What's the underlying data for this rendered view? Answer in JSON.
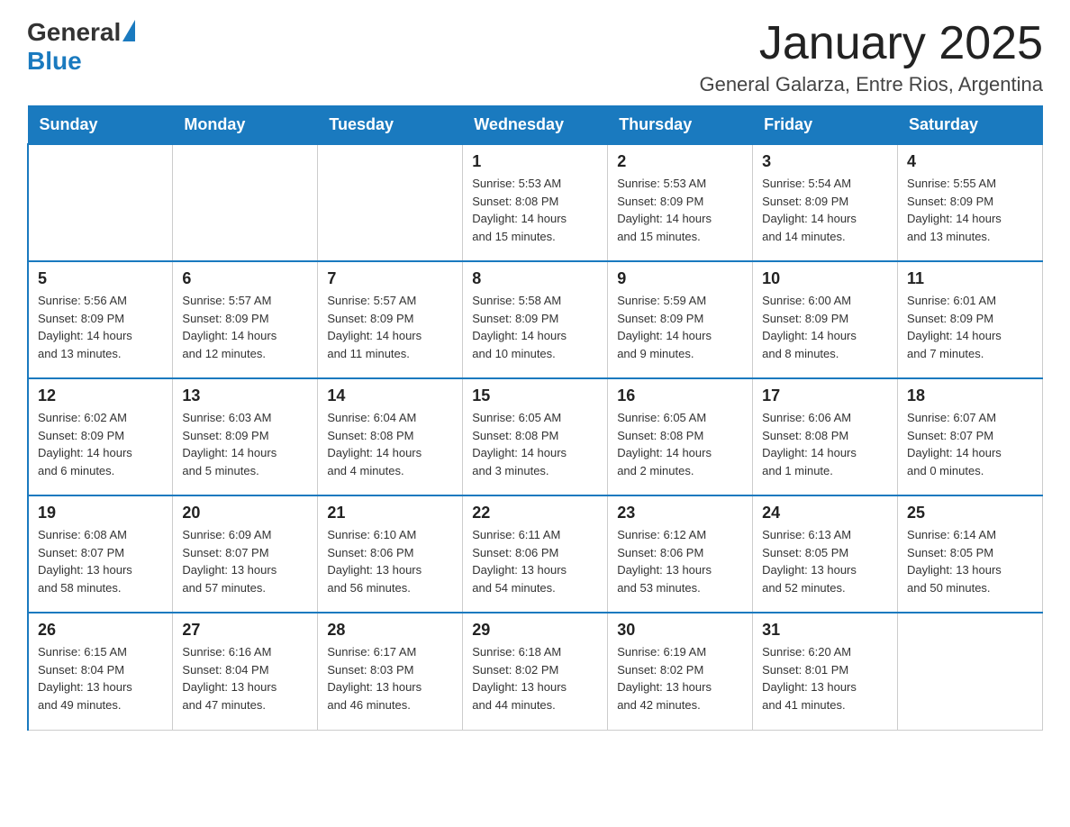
{
  "logo": {
    "general": "General",
    "blue": "Blue"
  },
  "title": "January 2025",
  "subtitle": "General Galarza, Entre Rios, Argentina",
  "days_of_week": [
    "Sunday",
    "Monday",
    "Tuesday",
    "Wednesday",
    "Thursday",
    "Friday",
    "Saturday"
  ],
  "weeks": [
    [
      {
        "day": "",
        "info": ""
      },
      {
        "day": "",
        "info": ""
      },
      {
        "day": "",
        "info": ""
      },
      {
        "day": "1",
        "info": "Sunrise: 5:53 AM\nSunset: 8:08 PM\nDaylight: 14 hours\nand 15 minutes."
      },
      {
        "day": "2",
        "info": "Sunrise: 5:53 AM\nSunset: 8:09 PM\nDaylight: 14 hours\nand 15 minutes."
      },
      {
        "day": "3",
        "info": "Sunrise: 5:54 AM\nSunset: 8:09 PM\nDaylight: 14 hours\nand 14 minutes."
      },
      {
        "day": "4",
        "info": "Sunrise: 5:55 AM\nSunset: 8:09 PM\nDaylight: 14 hours\nand 13 minutes."
      }
    ],
    [
      {
        "day": "5",
        "info": "Sunrise: 5:56 AM\nSunset: 8:09 PM\nDaylight: 14 hours\nand 13 minutes."
      },
      {
        "day": "6",
        "info": "Sunrise: 5:57 AM\nSunset: 8:09 PM\nDaylight: 14 hours\nand 12 minutes."
      },
      {
        "day": "7",
        "info": "Sunrise: 5:57 AM\nSunset: 8:09 PM\nDaylight: 14 hours\nand 11 minutes."
      },
      {
        "day": "8",
        "info": "Sunrise: 5:58 AM\nSunset: 8:09 PM\nDaylight: 14 hours\nand 10 minutes."
      },
      {
        "day": "9",
        "info": "Sunrise: 5:59 AM\nSunset: 8:09 PM\nDaylight: 14 hours\nand 9 minutes."
      },
      {
        "day": "10",
        "info": "Sunrise: 6:00 AM\nSunset: 8:09 PM\nDaylight: 14 hours\nand 8 minutes."
      },
      {
        "day": "11",
        "info": "Sunrise: 6:01 AM\nSunset: 8:09 PM\nDaylight: 14 hours\nand 7 minutes."
      }
    ],
    [
      {
        "day": "12",
        "info": "Sunrise: 6:02 AM\nSunset: 8:09 PM\nDaylight: 14 hours\nand 6 minutes."
      },
      {
        "day": "13",
        "info": "Sunrise: 6:03 AM\nSunset: 8:09 PM\nDaylight: 14 hours\nand 5 minutes."
      },
      {
        "day": "14",
        "info": "Sunrise: 6:04 AM\nSunset: 8:08 PM\nDaylight: 14 hours\nand 4 minutes."
      },
      {
        "day": "15",
        "info": "Sunrise: 6:05 AM\nSunset: 8:08 PM\nDaylight: 14 hours\nand 3 minutes."
      },
      {
        "day": "16",
        "info": "Sunrise: 6:05 AM\nSunset: 8:08 PM\nDaylight: 14 hours\nand 2 minutes."
      },
      {
        "day": "17",
        "info": "Sunrise: 6:06 AM\nSunset: 8:08 PM\nDaylight: 14 hours\nand 1 minute."
      },
      {
        "day": "18",
        "info": "Sunrise: 6:07 AM\nSunset: 8:07 PM\nDaylight: 14 hours\nand 0 minutes."
      }
    ],
    [
      {
        "day": "19",
        "info": "Sunrise: 6:08 AM\nSunset: 8:07 PM\nDaylight: 13 hours\nand 58 minutes."
      },
      {
        "day": "20",
        "info": "Sunrise: 6:09 AM\nSunset: 8:07 PM\nDaylight: 13 hours\nand 57 minutes."
      },
      {
        "day": "21",
        "info": "Sunrise: 6:10 AM\nSunset: 8:06 PM\nDaylight: 13 hours\nand 56 minutes."
      },
      {
        "day": "22",
        "info": "Sunrise: 6:11 AM\nSunset: 8:06 PM\nDaylight: 13 hours\nand 54 minutes."
      },
      {
        "day": "23",
        "info": "Sunrise: 6:12 AM\nSunset: 8:06 PM\nDaylight: 13 hours\nand 53 minutes."
      },
      {
        "day": "24",
        "info": "Sunrise: 6:13 AM\nSunset: 8:05 PM\nDaylight: 13 hours\nand 52 minutes."
      },
      {
        "day": "25",
        "info": "Sunrise: 6:14 AM\nSunset: 8:05 PM\nDaylight: 13 hours\nand 50 minutes."
      }
    ],
    [
      {
        "day": "26",
        "info": "Sunrise: 6:15 AM\nSunset: 8:04 PM\nDaylight: 13 hours\nand 49 minutes."
      },
      {
        "day": "27",
        "info": "Sunrise: 6:16 AM\nSunset: 8:04 PM\nDaylight: 13 hours\nand 47 minutes."
      },
      {
        "day": "28",
        "info": "Sunrise: 6:17 AM\nSunset: 8:03 PM\nDaylight: 13 hours\nand 46 minutes."
      },
      {
        "day": "29",
        "info": "Sunrise: 6:18 AM\nSunset: 8:02 PM\nDaylight: 13 hours\nand 44 minutes."
      },
      {
        "day": "30",
        "info": "Sunrise: 6:19 AM\nSunset: 8:02 PM\nDaylight: 13 hours\nand 42 minutes."
      },
      {
        "day": "31",
        "info": "Sunrise: 6:20 AM\nSunset: 8:01 PM\nDaylight: 13 hours\nand 41 minutes."
      },
      {
        "day": "",
        "info": ""
      }
    ]
  ]
}
